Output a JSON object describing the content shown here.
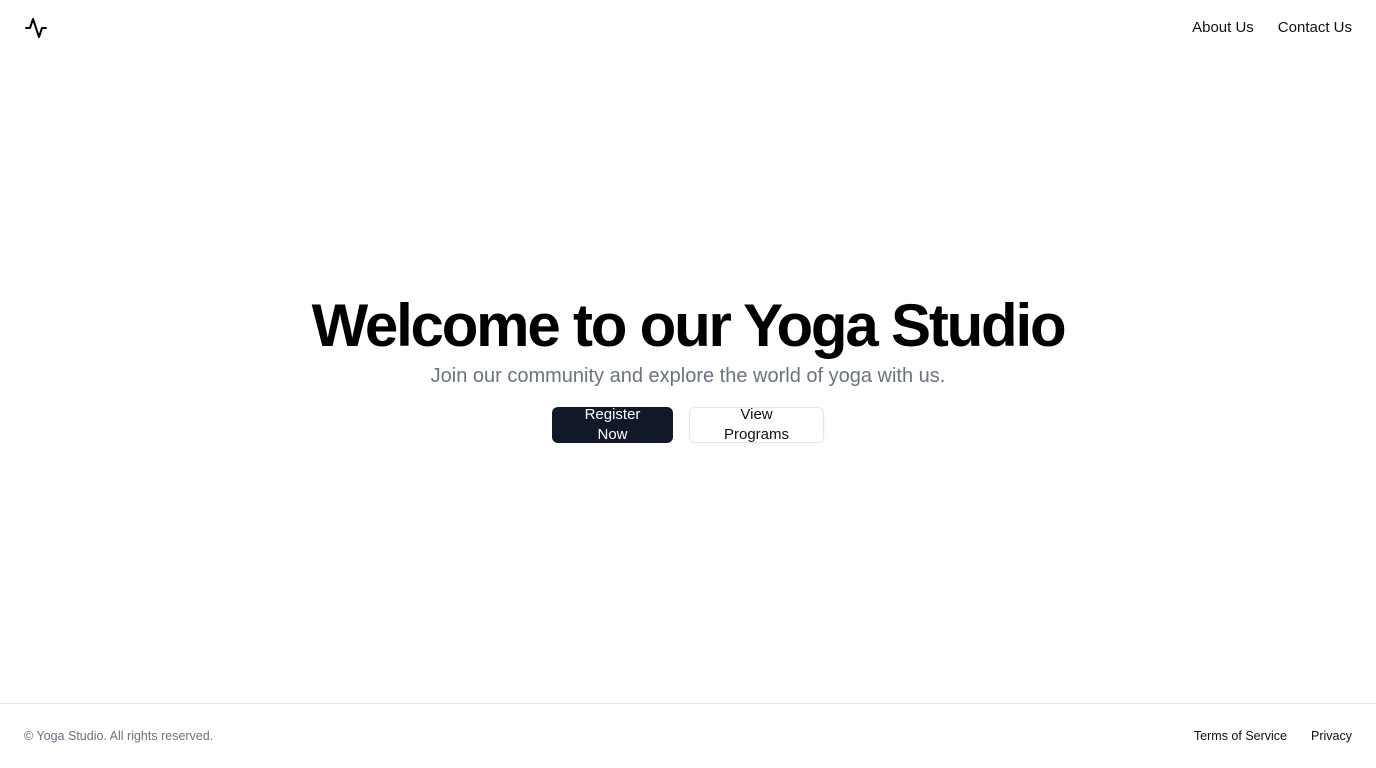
{
  "header": {
    "logo_icon": "activity-pulse-icon",
    "nav": [
      {
        "label": "About Us"
      },
      {
        "label": "Contact Us"
      }
    ]
  },
  "hero": {
    "title": "Welcome to our Yoga Studio",
    "subtitle": "Join our community and explore the world of yoga with us.",
    "primary_button": "Register Now",
    "secondary_button": "View Programs"
  },
  "footer": {
    "copyright": "© Yoga Studio. All rights reserved.",
    "links": [
      {
        "label": "Terms of Service"
      },
      {
        "label": "Privacy"
      }
    ]
  },
  "colors": {
    "primary_button_bg": "#111827",
    "subtitle_text": "#6b7280",
    "border": "#e5e7eb"
  }
}
